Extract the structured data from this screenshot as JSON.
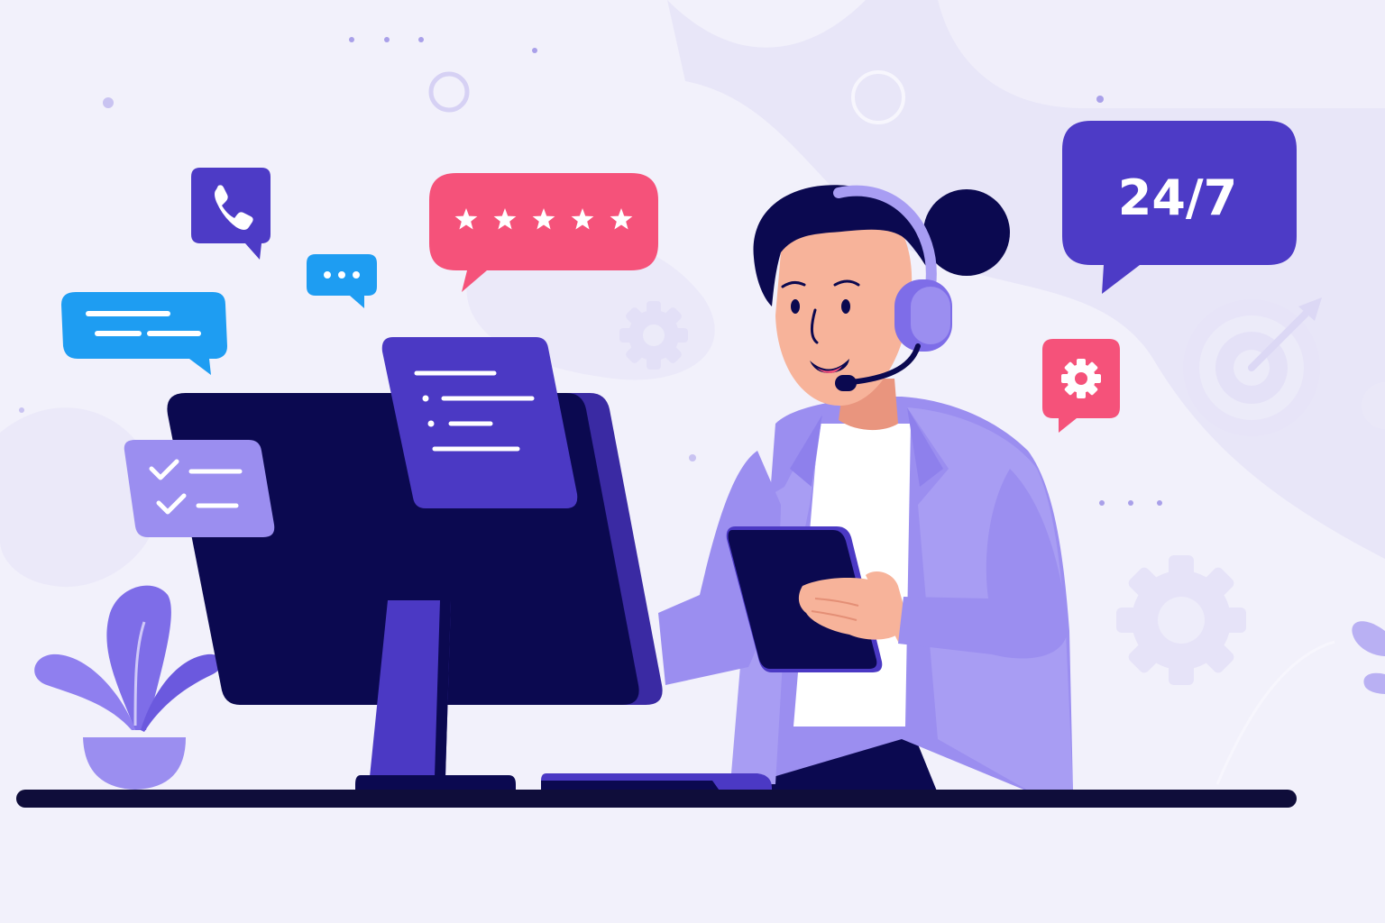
{
  "illustration": {
    "support_badge_text": "24/7",
    "rating_stars": 5
  },
  "colors": {
    "background": "#f2f1fb",
    "blob": "#e7e5f8",
    "navy": "#0b0950",
    "indigo": "#4b39c4",
    "lavender": "#9b8ef0",
    "light_lavender": "#b7adf4",
    "coral": "#f5527a",
    "sky_blue": "#1e9df2",
    "skin": "#f7b39a",
    "white": "#ffffff",
    "desk": "#0f0d3a"
  },
  "icons": [
    "phone-icon",
    "chat-dots-icon",
    "text-lines-icon",
    "star-icon",
    "gear-icon",
    "checklist-icon",
    "document-icon",
    "target-icon",
    "headset-icon",
    "plant-icon",
    "tablet-icon",
    "monitor-icon"
  ]
}
